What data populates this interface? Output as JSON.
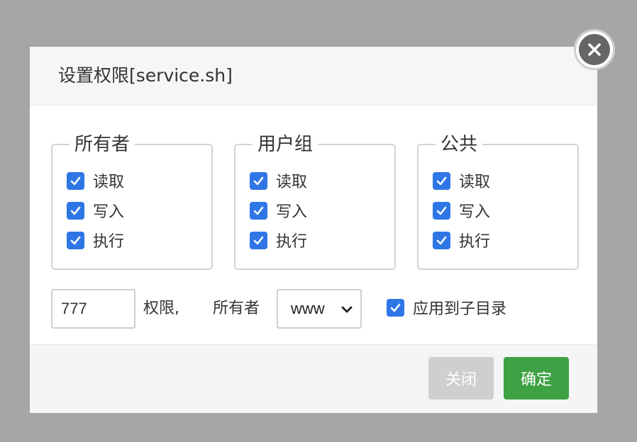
{
  "dialog": {
    "title": "设置权限[service.sh]"
  },
  "groups": [
    {
      "legend": "所有者",
      "permissions": [
        {
          "label": "读取",
          "checked": true
        },
        {
          "label": "写入",
          "checked": true
        },
        {
          "label": "执行",
          "checked": true
        }
      ]
    },
    {
      "legend": "用户组",
      "permissions": [
        {
          "label": "读取",
          "checked": true
        },
        {
          "label": "写入",
          "checked": true
        },
        {
          "label": "执行",
          "checked": true
        }
      ]
    },
    {
      "legend": "公共",
      "permissions": [
        {
          "label": "读取",
          "checked": true
        },
        {
          "label": "写入",
          "checked": true
        },
        {
          "label": "执行",
          "checked": true
        }
      ]
    }
  ],
  "settings": {
    "permission_value": "777",
    "permission_suffix": "权限,",
    "owner_label": "所有者",
    "owner_selected": "www",
    "apply_subdir_label": "应用到子目录",
    "apply_subdir_checked": true
  },
  "footer": {
    "close_label": "关闭",
    "confirm_label": "确定"
  },
  "colors": {
    "checkbox": "#2e76e6",
    "confirm": "#3ea244",
    "close_button": "#cfcfcf"
  },
  "icons": {
    "close": "close-icon",
    "checkbox": "checkmark-icon",
    "dropdown": "chevron-down-icon"
  }
}
